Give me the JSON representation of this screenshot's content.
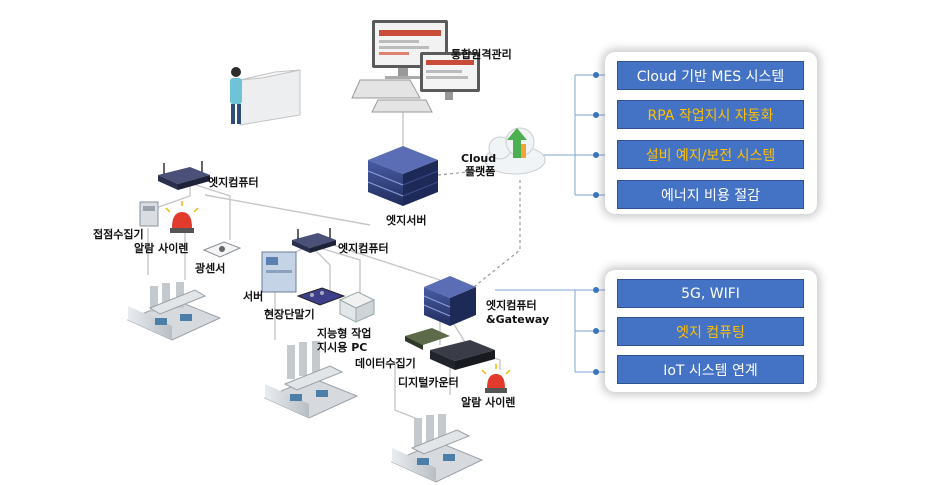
{
  "labels": {
    "integrated_remote": "통합원격관리",
    "cloud_platform_1": "Cloud",
    "cloud_platform_2": "플랫폼",
    "edge_server": "엣지서버",
    "edge_computer_left": "엣지컴퓨터",
    "edge_computer_mid": "엣지컴퓨터",
    "contact_collector": "접점수집기",
    "alarm_siren_left": "알람 사이렌",
    "light_sensor": "광센서",
    "server": "서버",
    "field_terminal": "현장단말기",
    "smart_pc_1": "지능형 작업",
    "smart_pc_2": "지시용 PC",
    "edge_gateway_1": "엣지컴퓨터",
    "edge_gateway_2": "&Gateway",
    "data_collector": "데이터수집기",
    "digital_counter": "디지털카운터",
    "alarm_siren_right": "알람 사이렌"
  },
  "panel_top": [
    {
      "label": "Cloud 기반 MES 시스템",
      "accent": false
    },
    {
      "label": "RPA 작업지시 자동화",
      "accent": true
    },
    {
      "label": "설비 예지/보전 시스템",
      "accent": true
    },
    {
      "label": "에너지 비용 절감",
      "accent": false
    }
  ],
  "panel_bottom": [
    {
      "label": "5G, WIFI",
      "accent": false
    },
    {
      "label": "엣지 컴퓨팅",
      "accent": true
    },
    {
      "label": "IoT 시스템 연계",
      "accent": false
    }
  ],
  "colors": {
    "button_fill": "#4472c4",
    "button_text": "#ffffff",
    "button_accent_text": "#ffc000",
    "connector_dot": "#3a78c2",
    "cloud_green": "#4caf50",
    "server_navy": "#2e3f7a"
  }
}
